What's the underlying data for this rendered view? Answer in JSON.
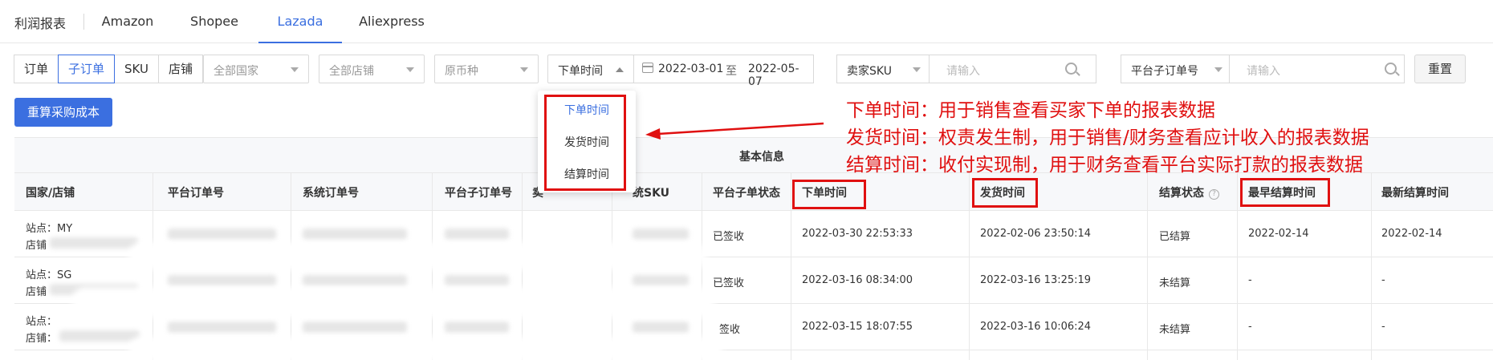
{
  "tabs": {
    "title": "利润报表",
    "items": [
      "Amazon",
      "Shopee",
      "Lazada",
      "Aliexpress"
    ],
    "active": "Lazada"
  },
  "filters": {
    "order_types": [
      "订单",
      "子订单",
      "SKU",
      "店铺"
    ],
    "order_type_active": "子订单",
    "country": "全部国家",
    "store": "全部店铺",
    "currency": "原币种",
    "time_type": "下单时间",
    "date_start": "2022-03-01",
    "date_sep": "至",
    "date_end": "2022-05-07",
    "sku_label": "卖家SKU",
    "sku_placeholder": "请输入",
    "sub_order_label": "平台子订单号",
    "sub_order_placeholder": "请输入",
    "reset": "重置"
  },
  "actions": {
    "recalc": "重算采购成本"
  },
  "dropdown": {
    "options": [
      "下单时间",
      "发货时间",
      "结算时间"
    ],
    "selected": "下单时间"
  },
  "annotations": [
    "下单时间：用于销售查看买家下单的报表数据",
    "发货时间：权责发生制，用于销售/财务查看应计收入的报表数据",
    "结算时间：收付实现制，用于财务查看平台实际打款的报表数据"
  ],
  "table": {
    "group_header": "基本信息",
    "columns": [
      "国家/店铺",
      "平台订单号",
      "系统订单号",
      "平台子订单号",
      "卖",
      "统SKU",
      "平台子单状态",
      "下单时间",
      "发货时间",
      "结算状态",
      "最早结算时间",
      "最新结算时间"
    ],
    "rows": [
      {
        "site": "站点：MY",
        "shop": "店铺",
        "status": "已签收",
        "order_time": "2022-03-30 22:53:33",
        "ship_time": "2022-02-06 23:50:14",
        "settle_status": "已结算",
        "earliest": "2022-02-14",
        "latest": "2022-02-14"
      },
      {
        "site": "站点：SG",
        "shop": "店铺",
        "status": "已签收",
        "order_time": "2022-03-16 08:34:00",
        "ship_time": "2022-03-16 13:25:19",
        "settle_status": "未结算",
        "earliest": "-",
        "latest": "-"
      },
      {
        "site": "站点：",
        "shop": "店铺：",
        "status": "签收",
        "order_time": "2022-03-15 18:07:55",
        "ship_time": "2022-03-16 10:06:24",
        "settle_status": "未结算",
        "earliest": "-",
        "latest": "-"
      }
    ]
  },
  "colors": {
    "accent": "#3b6fe0",
    "highlight": "#e01010"
  }
}
